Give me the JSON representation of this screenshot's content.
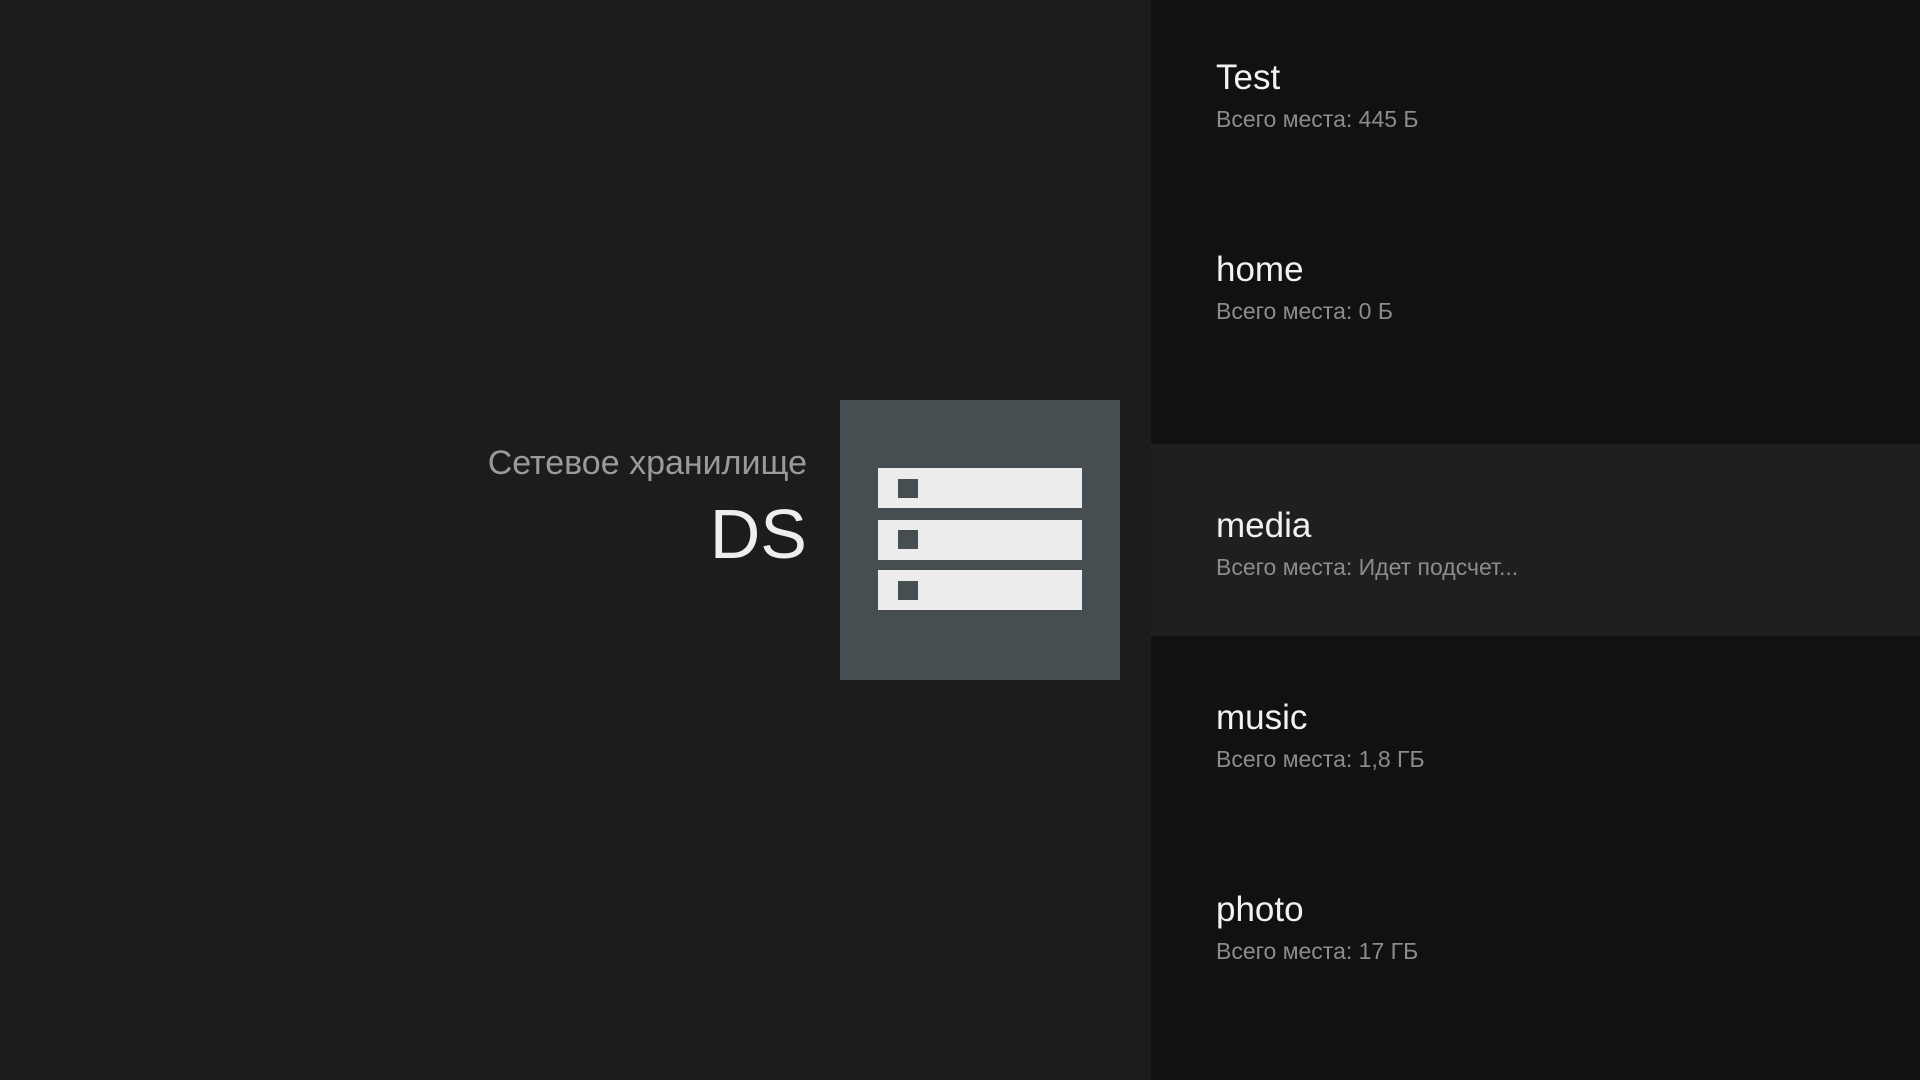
{
  "device": {
    "subtitle": "Сетевое хранилище",
    "name": "DS",
    "icon": "server-rack-icon",
    "tile_color": "#474e51"
  },
  "shares": [
    {
      "name": "Test",
      "size": "Всего места: 445 Б",
      "selected": false
    },
    {
      "name": "home",
      "size": "Всего места: 0 Б",
      "selected": false
    },
    {
      "name": "media",
      "size": "Всего места: Идет подсчет...",
      "selected": true
    },
    {
      "name": "music",
      "size": "Всего места: 1,8 ГБ",
      "selected": false
    },
    {
      "name": "photo",
      "size": "Всего места: 17 ГБ",
      "selected": false
    }
  ],
  "colors": {
    "background": "#1c1c1c",
    "panel": "#111111",
    "selected_row": "#1f1f1f"
  }
}
